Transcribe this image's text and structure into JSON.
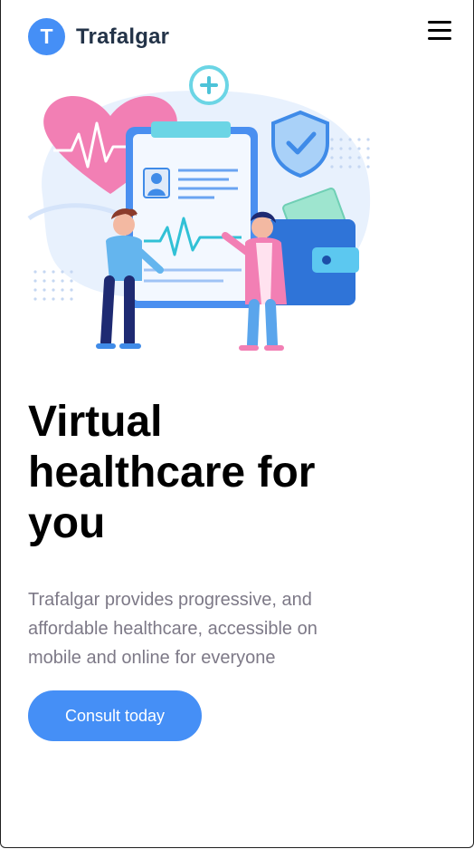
{
  "brand": {
    "initial": "T",
    "name": "Trafalgar",
    "color": "#458ff6"
  },
  "nav": {
    "menu_icon": "hamburger-menu-icon"
  },
  "hero": {
    "illustration": "virtual-healthcare-illustration",
    "headline": "Virtual healthcare for you",
    "description": "Trafalgar provides progressive, and affordable healthcare, accessible on mobile and online for everyone",
    "cta_label": "Consult today"
  }
}
